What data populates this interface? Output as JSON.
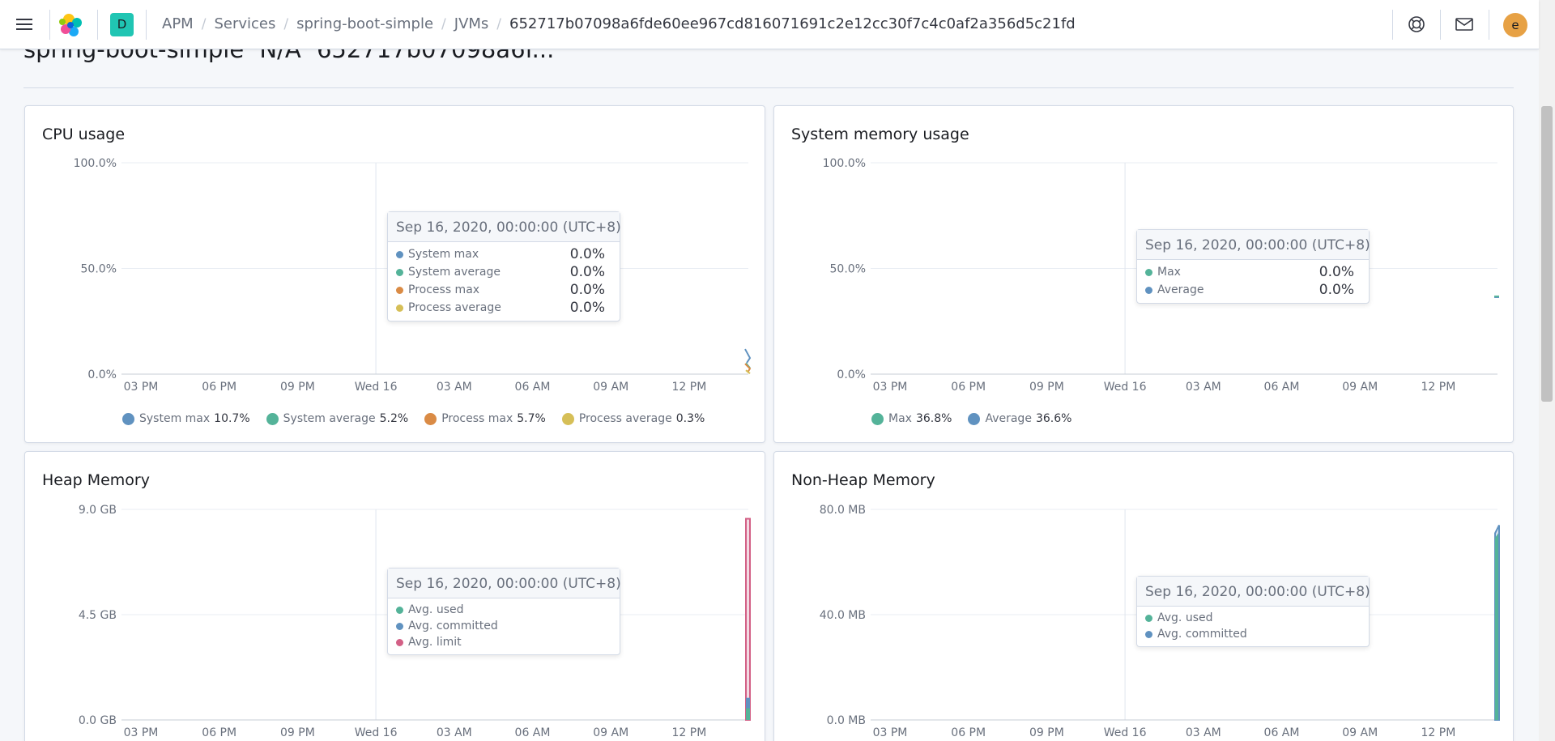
{
  "page": {
    "behind_header_text": "spring-boot-simple    N/A    652717b07098a6f..."
  },
  "topbar": {
    "space_initial": "D",
    "user_initial": "e",
    "breadcrumbs": [
      "APM",
      "Services",
      "spring-boot-simple",
      "JVMs",
      "652717b07098a6fde60ee967cd816071691c2e12cc30f7c4c0af2a356d5c21fd"
    ],
    "icons": [
      "menu-icon",
      "elastic-logo",
      "help-icon",
      "mail-icon"
    ]
  },
  "colors": {
    "blue": "#6092c0",
    "green": "#54b399",
    "orange": "#da8b45",
    "yellow": "#d6bf57",
    "pink": "#d36086",
    "accent": "#20c5b3"
  },
  "x_ticks": [
    "03 PM",
    "06 PM",
    "09 PM",
    "Wed 16",
    "03 AM",
    "06 AM",
    "09 AM",
    "12 PM"
  ],
  "charts": {
    "cpu": {
      "title": "CPU usage",
      "y_ticks": [
        "100.0%",
        "50.0%",
        "0.0%"
      ],
      "tooltip": {
        "date": "Sep 16, 2020, 00:00:00 (UTC+8)",
        "rows": [
          {
            "name": "System max",
            "value": "0.0%",
            "color": "#6092c0"
          },
          {
            "name": "System average",
            "value": "0.0%",
            "color": "#54b399"
          },
          {
            "name": "Process max",
            "value": "0.0%",
            "color": "#da8b45"
          },
          {
            "name": "Process average",
            "value": "0.0%",
            "color": "#d6bf57"
          }
        ]
      },
      "legend": [
        {
          "name": "System max",
          "value": "10.7%",
          "color": "#6092c0"
        },
        {
          "name": "System average",
          "value": "5.2%",
          "color": "#54b399"
        },
        {
          "name": "Process max",
          "value": "5.7%",
          "color": "#da8b45"
        },
        {
          "name": "Process average",
          "value": "0.3%",
          "color": "#d6bf57"
        }
      ]
    },
    "memory": {
      "title": "System memory usage",
      "y_ticks": [
        "100.0%",
        "50.0%",
        "0.0%"
      ],
      "tooltip": {
        "date": "Sep 16, 2020, 00:00:00 (UTC+8)",
        "rows": [
          {
            "name": "Max",
            "value": "0.0%",
            "color": "#54b399"
          },
          {
            "name": "Average",
            "value": "0.0%",
            "color": "#6092c0"
          }
        ]
      },
      "legend": [
        {
          "name": "Max",
          "value": "36.8%",
          "color": "#54b399"
        },
        {
          "name": "Average",
          "value": "36.6%",
          "color": "#6092c0"
        }
      ]
    },
    "heap": {
      "title": "Heap Memory",
      "y_ticks": [
        "9.0 GB",
        "4.5 GB",
        "0.0 GB"
      ],
      "tooltip": {
        "date": "Sep 16, 2020, 00:00:00 (UTC+8)",
        "rows": [
          {
            "name": "Avg. used",
            "color": "#54b399"
          },
          {
            "name": "Avg. committed",
            "color": "#6092c0"
          },
          {
            "name": "Avg. limit",
            "color": "#d36086"
          }
        ]
      }
    },
    "nonheap": {
      "title": "Non-Heap Memory",
      "y_ticks": [
        "80.0 MB",
        "40.0 MB",
        "0.0 MB"
      ],
      "tooltip": {
        "date": "Sep 16, 2020, 00:00:00 (UTC+8)",
        "rows": [
          {
            "name": "Avg. used",
            "color": "#54b399"
          },
          {
            "name": "Avg. committed",
            "color": "#6092c0"
          }
        ]
      }
    }
  },
  "chart_data": [
    {
      "type": "line",
      "title": "CPU usage",
      "x": [
        "03 PM",
        "06 PM",
        "09 PM",
        "Wed 16",
        "03 AM",
        "06 AM",
        "09 AM",
        "12 PM"
      ],
      "ylim": [
        0,
        100
      ],
      "y_unit": "%",
      "series": [
        {
          "name": "System max",
          "latest": 10.7
        },
        {
          "name": "System average",
          "latest": 5.2
        },
        {
          "name": "Process max",
          "latest": 5.7
        },
        {
          "name": "Process average",
          "latest": 0.3
        }
      ]
    },
    {
      "type": "line",
      "title": "System memory usage",
      "x": [
        "03 PM",
        "06 PM",
        "09 PM",
        "Wed 16",
        "03 AM",
        "06 AM",
        "09 AM",
        "12 PM"
      ],
      "ylim": [
        0,
        100
      ],
      "y_unit": "%",
      "series": [
        {
          "name": "Max",
          "latest": 36.8
        },
        {
          "name": "Average",
          "latest": 36.6
        }
      ]
    },
    {
      "type": "area",
      "title": "Heap Memory",
      "x": [
        "03 PM",
        "06 PM",
        "09 PM",
        "Wed 16",
        "03 AM",
        "06 AM",
        "09 AM",
        "12 PM"
      ],
      "ylim": [
        0,
        9
      ],
      "y_unit": "GB",
      "series": [
        {
          "name": "Avg. used",
          "latest": 0.5
        },
        {
          "name": "Avg. committed",
          "latest": 0.6
        },
        {
          "name": "Avg. limit",
          "latest": 8.6
        }
      ]
    },
    {
      "type": "area",
      "title": "Non-Heap Memory",
      "x": [
        "03 PM",
        "06 PM",
        "09 PM",
        "Wed 16",
        "03 AM",
        "06 AM",
        "09 AM",
        "12 PM"
      ],
      "ylim": [
        0,
        80
      ],
      "y_unit": "MB",
      "series": [
        {
          "name": "Avg. used",
          "latest": 71
        },
        {
          "name": "Avg. committed",
          "latest": 74
        }
      ]
    }
  ]
}
